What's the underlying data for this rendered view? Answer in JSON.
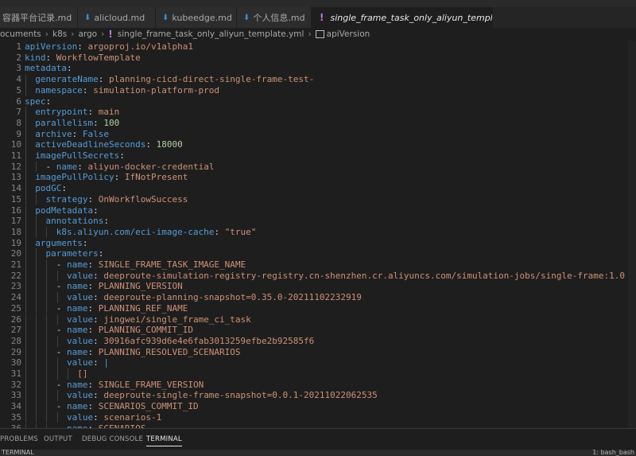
{
  "tabs": [
    {
      "label": "容器平台记录.md",
      "modified": true,
      "icon": "markdown-icon"
    },
    {
      "label": "alicloud.md",
      "icon": "markdown-icon"
    },
    {
      "label": "kubeedge.md",
      "icon": "markdown-icon"
    },
    {
      "label": "个人信息.md",
      "icon": "markdown-icon"
    },
    {
      "label": "single_frame_task_only_aliyun_template.yml",
      "active": true,
      "icon": "yaml-icon",
      "close": "×"
    }
  ],
  "breadcrumb": [
    "ocuments",
    "k8s",
    "argo",
    "single_frame_task_only_aliyun_template.yml",
    "apiVersion"
  ],
  "lines": [
    [
      [
        "k",
        "apiVersion"
      ],
      [
        "p",
        ": "
      ],
      [
        "s",
        "argoproj.io/v1alpha1"
      ]
    ],
    [
      [
        "k",
        "kind"
      ],
      [
        "p",
        ": "
      ],
      [
        "s",
        "WorkflowTemplate"
      ]
    ],
    [
      [
        "k",
        "metadata"
      ],
      [
        "p",
        ":"
      ]
    ],
    [
      [
        "p",
        "  "
      ],
      [
        "k",
        "generateName"
      ],
      [
        "p",
        ": "
      ],
      [
        "s",
        "planning-cicd-direct-single-frame-test-"
      ]
    ],
    [
      [
        "p",
        "  "
      ],
      [
        "k",
        "namespace"
      ],
      [
        "p",
        ": "
      ],
      [
        "s",
        "simulation-platform-prod"
      ]
    ],
    [
      [
        "k",
        "spec"
      ],
      [
        "p",
        ":"
      ]
    ],
    [
      [
        "p",
        "  "
      ],
      [
        "k",
        "entrypoint"
      ],
      [
        "p",
        ": "
      ],
      [
        "s",
        "main"
      ]
    ],
    [
      [
        "p",
        "  "
      ],
      [
        "k",
        "parallelism"
      ],
      [
        "p",
        ": "
      ],
      [
        "n",
        "100"
      ]
    ],
    [
      [
        "p",
        "  "
      ],
      [
        "k",
        "archive"
      ],
      [
        "p",
        ": "
      ],
      [
        "k",
        "False"
      ]
    ],
    [
      [
        "p",
        "  "
      ],
      [
        "k",
        "activeDeadlineSeconds"
      ],
      [
        "p",
        ": "
      ],
      [
        "n",
        "18000"
      ]
    ],
    [
      [
        "p",
        "  "
      ],
      [
        "k",
        "imagePullSecrets"
      ],
      [
        "p",
        ":"
      ]
    ],
    [
      [
        "p",
        "    - "
      ],
      [
        "k",
        "name"
      ],
      [
        "p",
        ": "
      ],
      [
        "s",
        "aliyun-docker-credential"
      ]
    ],
    [
      [
        "p",
        "  "
      ],
      [
        "k",
        "imagePullPolicy"
      ],
      [
        "p",
        ": "
      ],
      [
        "s",
        "IfNotPresent"
      ]
    ],
    [
      [
        "p",
        "  "
      ],
      [
        "k",
        "podGC"
      ],
      [
        "p",
        ":"
      ]
    ],
    [
      [
        "p",
        "    "
      ],
      [
        "k",
        "strategy"
      ],
      [
        "p",
        ": "
      ],
      [
        "s",
        "OnWorkflowSuccess"
      ]
    ],
    [
      [
        "p",
        "  "
      ],
      [
        "k",
        "podMetadata"
      ],
      [
        "p",
        ":"
      ]
    ],
    [
      [
        "p",
        "    "
      ],
      [
        "k",
        "annotations"
      ],
      [
        "p",
        ":"
      ]
    ],
    [
      [
        "p",
        "      "
      ],
      [
        "k",
        "k8s.aliyun.com/eci-image-cache"
      ],
      [
        "p",
        ": "
      ],
      [
        "s",
        "\"true\""
      ]
    ],
    [
      [
        "p",
        "  "
      ],
      [
        "k",
        "arguments"
      ],
      [
        "p",
        ":"
      ]
    ],
    [
      [
        "p",
        "    "
      ],
      [
        "k",
        "parameters"
      ],
      [
        "p",
        ":"
      ]
    ],
    [
      [
        "p",
        "      - "
      ],
      [
        "k",
        "name"
      ],
      [
        "p",
        ": "
      ],
      [
        "s",
        "SINGLE_FRAME_TASK_IMAGE_NAME"
      ]
    ],
    [
      [
        "p",
        "        "
      ],
      [
        "k",
        "value"
      ],
      [
        "p",
        ": "
      ],
      [
        "s",
        "deeproute-simulation-registry-registry.cn-shenzhen.cr.aliyuncs.com/simulation-jobs/single-frame:1.0"
      ]
    ],
    [
      [
        "p",
        "      - "
      ],
      [
        "k",
        "name"
      ],
      [
        "p",
        ": "
      ],
      [
        "s",
        "PLANNING_VERSION"
      ]
    ],
    [
      [
        "p",
        "        "
      ],
      [
        "k",
        "value"
      ],
      [
        "p",
        ": "
      ],
      [
        "s",
        "deeproute-planning-snapshot=0.35.0-20211102232919"
      ]
    ],
    [
      [
        "p",
        "      - "
      ],
      [
        "k",
        "name"
      ],
      [
        "p",
        ": "
      ],
      [
        "s",
        "PLANNING_REF_NAME"
      ]
    ],
    [
      [
        "p",
        "        "
      ],
      [
        "k",
        "value"
      ],
      [
        "p",
        ": "
      ],
      [
        "s",
        "jingwei/single_frame_ci_task"
      ]
    ],
    [
      [
        "p",
        "      - "
      ],
      [
        "k",
        "name"
      ],
      [
        "p",
        ": "
      ],
      [
        "s",
        "PLANNING_COMMIT_ID"
      ]
    ],
    [
      [
        "p",
        "        "
      ],
      [
        "k",
        "value"
      ],
      [
        "p",
        ": "
      ],
      [
        "s",
        "30916afc939d6e4e6fab3013259efbe2b92585f6"
      ]
    ],
    [
      [
        "p",
        "      - "
      ],
      [
        "k",
        "name"
      ],
      [
        "p",
        ": "
      ],
      [
        "s",
        "PLANNING_RESOLVED_SCENARIOS"
      ]
    ],
    [
      [
        "p",
        "        "
      ],
      [
        "k",
        "value"
      ],
      [
        "p",
        ": "
      ],
      [
        "k",
        "|"
      ]
    ],
    [
      [
        "p",
        "          "
      ],
      [
        "s",
        "[]"
      ]
    ],
    [
      [
        "p",
        "      - "
      ],
      [
        "k",
        "name"
      ],
      [
        "p",
        ": "
      ],
      [
        "s",
        "SINGLE_FRAME_VERSION"
      ]
    ],
    [
      [
        "p",
        "        "
      ],
      [
        "k",
        "value"
      ],
      [
        "p",
        ": "
      ],
      [
        "s",
        "deeproute-single-frame-snapshot=0.0.1-20211022062535"
      ]
    ],
    [
      [
        "p",
        "      - "
      ],
      [
        "k",
        "name"
      ],
      [
        "p",
        ": "
      ],
      [
        "s",
        "SCENARIOS_COMMIT_ID"
      ]
    ],
    [
      [
        "p",
        "        "
      ],
      [
        "k",
        "value"
      ],
      [
        "p",
        ": "
      ],
      [
        "s",
        "scenarios-1"
      ]
    ],
    [
      [
        "p",
        "      - "
      ],
      [
        "k",
        "name"
      ],
      [
        "p",
        ": "
      ],
      [
        "s",
        "SCENARIOS"
      ]
    ]
  ],
  "panel_tabs": [
    "PROBLEMS",
    "OUTPUT",
    "DEBUG CONSOLE",
    "TERMINAL"
  ],
  "active_panel_tab": "TERMINAL",
  "terminal": {
    "left": "TERMINAL",
    "right": "1: bash_bash"
  }
}
